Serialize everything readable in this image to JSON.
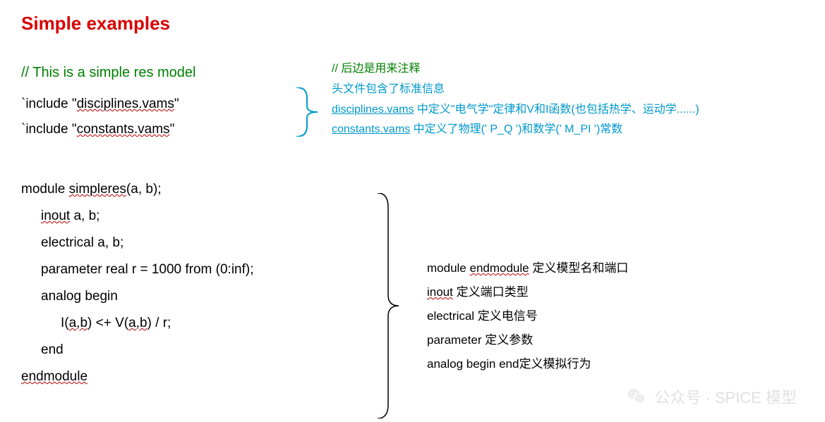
{
  "title": "Simple examples",
  "code": {
    "comment": "// This is a simple res model",
    "include1_prefix": "`include \"",
    "include1_file": "disciplines.vams",
    "include1_suffix": "\"",
    "include2_prefix": "`include \"",
    "include2_file": "constants.vams",
    "include2_suffix": "\"",
    "module_kw": "module ",
    "module_name": "simpleres",
    "module_args": "(a, b);",
    "inout_kw": "inout",
    "inout_rest": " a, b;",
    "electrical": "electrical a, b;",
    "parameter": "parameter real r = 1000 from (0:inf);",
    "analog_begin": "analog begin",
    "body_I": "I(",
    "body_ab1": "a,b",
    "body_mid": ") <+ V(",
    "body_ab2": "a,b",
    "body_end": ") / r;",
    "end": "end",
    "endmodule": "endmodule"
  },
  "notes1": {
    "line1": "// 后边是用来注释",
    "line2": "头文件包含了标准信息",
    "line3_a": "disciplines.vams",
    "line3_b": " 中定义\"电气学\"定律和V和I函数(也包括热学、运动学......)",
    "line4_a": "constants.vams",
    "line4_b": " 中定义了物理(' P_Q ')和数学(' M_PI ')常数"
  },
  "notes2": {
    "line1_a": "module  ",
    "line1_b": "endmodule",
    "line1_c": " 定义模型名和端口",
    "line2_a": "inout",
    "line2_b": " 定义端口类型",
    "line3": "electrical 定义电信号",
    "line4": "parameter 定义参数",
    "line5": "analog begin end定义模拟行为"
  },
  "watermark": {
    "text": "公众号 · SPICE 模型"
  }
}
